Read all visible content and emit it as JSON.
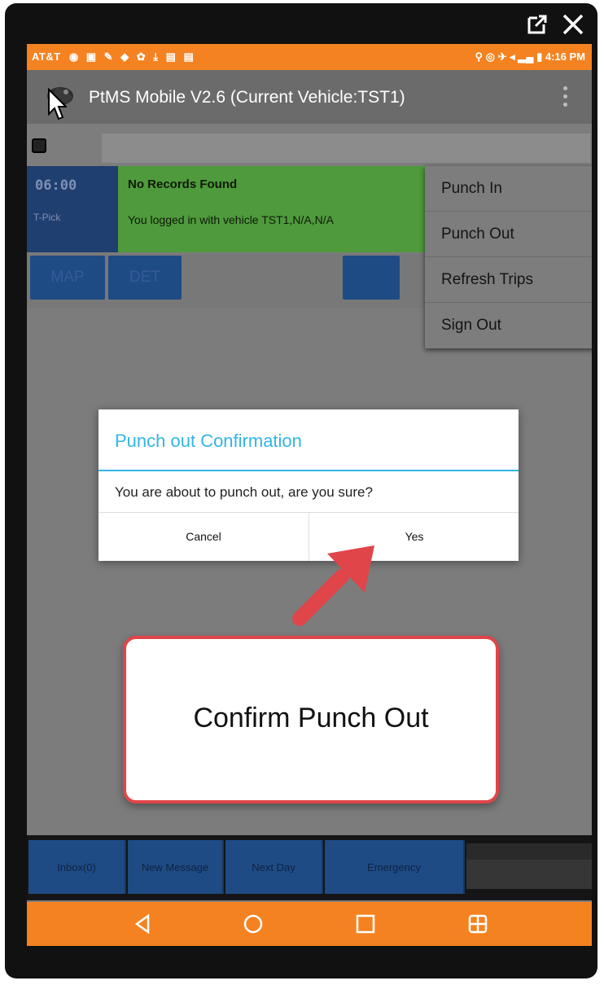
{
  "window": {
    "external_icon": "external-link-icon",
    "close_icon": "close-icon"
  },
  "statusbar": {
    "carrier": "AT&T",
    "time": "4:16 PM"
  },
  "appbar": {
    "title": "PtMS Mobile V2.6  (Current Vehicle:TST1)"
  },
  "record": {
    "time": "06:00",
    "sub": "T-Pick",
    "title": "No Records Found",
    "message": "You logged in with vehicle TST1,N/A,N/A"
  },
  "buttons": {
    "map": "MAP",
    "det": "DET"
  },
  "menu": {
    "items": [
      "Punch In",
      "Punch Out",
      "Refresh Trips",
      "Sign Out"
    ]
  },
  "dialog": {
    "title": "Punch out Confirmation",
    "message": "You are about to punch out, are you sure?",
    "cancel": "Cancel",
    "yes": "Yes"
  },
  "callout": {
    "text": "Confirm Punch Out"
  },
  "bottom_buttons": {
    "inbox": "Inbox(0)",
    "new_message": "New Message",
    "next_day": "Next Day",
    "emergency": "Emergency"
  },
  "colors": {
    "accent_orange": "#f58220",
    "dialog_blue": "#33b5e5",
    "callout_red": "#e0454a"
  }
}
